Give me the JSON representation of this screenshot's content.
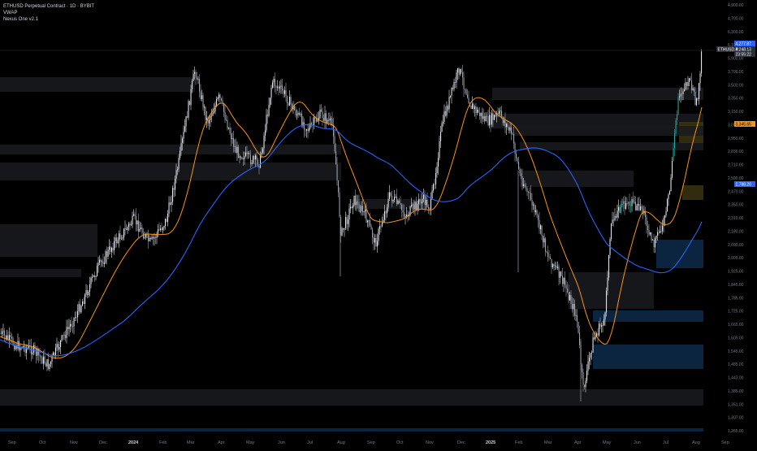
{
  "chart": {
    "legend": {
      "symbol_line": "ETHUSD Perpetual Contract · 1D · BYBIT",
      "indicator_1": "VWAP",
      "indicator_2": "Nexus One v2.1"
    },
    "price_axis_ticks": [
      "4,900.00",
      "4,700.00",
      "6,300.00",
      "6,100.00",
      "5,900.00",
      "3,700.00",
      "3,500.00",
      "3,350.00",
      "3,150.00",
      "3,050.00",
      "2,950.00",
      "2,830.00",
      "2,710.00",
      "2,590.00",
      "2,470.00",
      "2,350.00",
      "2,310.00",
      "2,180.00",
      "2,090.00",
      "2,005.00",
      "1,925.00",
      "1,845.00",
      "1,785.00",
      "1,725.00",
      "1,665.00",
      "1,605.00",
      "1,545.00",
      "1,485.00",
      "1,443.00",
      "1,385.00",
      "1,351.00",
      "1,307.00",
      "1,265.00"
    ],
    "price_tags": [
      {
        "label": "4,277.87",
        "color": "#2962ff",
        "kind": "last-price"
      },
      {
        "label": "4,248.13",
        "color": "#9aa0aa",
        "kind": "mark"
      },
      {
        "label": "ETHUSD.P",
        "color": "#9aa0aa",
        "kind": "symbol"
      },
      {
        "label": "23:55:22",
        "color": "#9aa0aa",
        "kind": "countdown"
      },
      {
        "label": "3,345.65",
        "color": "#f7931a",
        "kind": "ma-fast"
      },
      {
        "label": "2,788.20",
        "color": "#2962ff",
        "kind": "ma-slow"
      }
    ],
    "time_axis_ticks": [
      "Sep",
      "Oct",
      "Nov",
      "Dec",
      "2024",
      "Feb",
      "Mar",
      "Apr",
      "May",
      "Jun",
      "Jul",
      "Aug",
      "Sep",
      "Oct",
      "Nov",
      "Dec",
      "2025",
      "Feb",
      "Mar",
      "Apr",
      "May",
      "Jun",
      "Jul",
      "Aug",
      "Sep"
    ],
    "bold_time_ticks": [
      "2024",
      "2025"
    ],
    "colors": {
      "background": "#000000",
      "candle_up": "#e0e3eb",
      "candle_down": "#9aa0aa",
      "candle_green": "#26a69a",
      "ma_fast": "#f7931a",
      "ma_slow": "#2962ff",
      "zone_gray": "#1a1b1f",
      "zone_blue": "#0d2a4a",
      "zone_yellow": "#3a3410"
    }
  },
  "chart_data": {
    "type": "candlestick",
    "symbol": "ETHUSD Perpetual Contract · 1D · BYBIT",
    "indicators": [
      "VWAP",
      "Nexus One v2.1"
    ],
    "x_start": "2023-09",
    "x_end": "2025-09",
    "y_range_visible": [
      1265,
      4900
    ],
    "last_price": 4277.87,
    "key_points": [
      {
        "date": "2023-10-12",
        "close": 1540
      },
      {
        "date": "2024-03-12",
        "close": 4060
      },
      {
        "date": "2024-05-27",
        "close": 3900
      },
      {
        "date": "2024-08-05",
        "close": 2200
      },
      {
        "date": "2024-12-16",
        "close": 4100
      },
      {
        "date": "2025-04-09",
        "close": 1390
      },
      {
        "date": "2025-08-12",
        "close": 4277.87
      }
    ],
    "ma_fast_last": 3345.65,
    "ma_slow_last": 2788.2
  }
}
